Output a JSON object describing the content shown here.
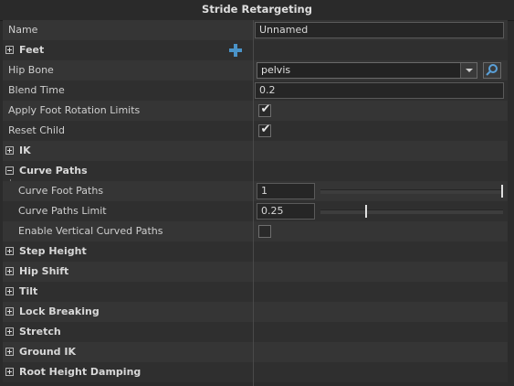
{
  "window": {
    "title": "Stride Retargeting"
  },
  "rows": {
    "name": {
      "label": "Name",
      "value": "Unnamed"
    },
    "feet": {
      "label": "Feet"
    },
    "hip_bone": {
      "label": "Hip Bone",
      "value": "pelvis"
    },
    "blend_time": {
      "label": "Blend Time",
      "value": "0.2"
    },
    "apply_foot_rotation_limits": {
      "label": "Apply Foot Rotation Limits",
      "checked": true
    },
    "reset_child": {
      "label": "Reset Child",
      "checked": true
    },
    "ik": {
      "label": "IK"
    },
    "curve_paths": {
      "label": "Curve Paths"
    },
    "curve_foot_paths": {
      "label": "Curve Foot Paths",
      "value": "1",
      "slider_fraction": 1.0
    },
    "curve_paths_limit": {
      "label": "Curve Paths Limit",
      "value": "0.25",
      "slider_fraction": 0.25
    },
    "enable_vertical_curved_paths": {
      "label": "Enable Vertical Curved Paths",
      "checked": false
    },
    "step_height": {
      "label": "Step Height"
    },
    "hip_shift": {
      "label": "Hip Shift"
    },
    "tilt": {
      "label": "Tilt"
    },
    "lock_breaking": {
      "label": "Lock Breaking"
    },
    "stretch": {
      "label": "Stretch"
    },
    "ground_ik": {
      "label": "Ground IK"
    },
    "root_height_damping": {
      "label": "Root Height Damping"
    }
  },
  "colors": {
    "add_icon": "#4a93c8",
    "pick_icon": "#5aa0d8"
  },
  "icons": {
    "expander_collapsed": "plus-box-icon",
    "expander_expanded": "minus-box-icon",
    "add": "plus-icon",
    "pick": "magnifier-icon",
    "dropdown": "chevron-down-icon"
  }
}
